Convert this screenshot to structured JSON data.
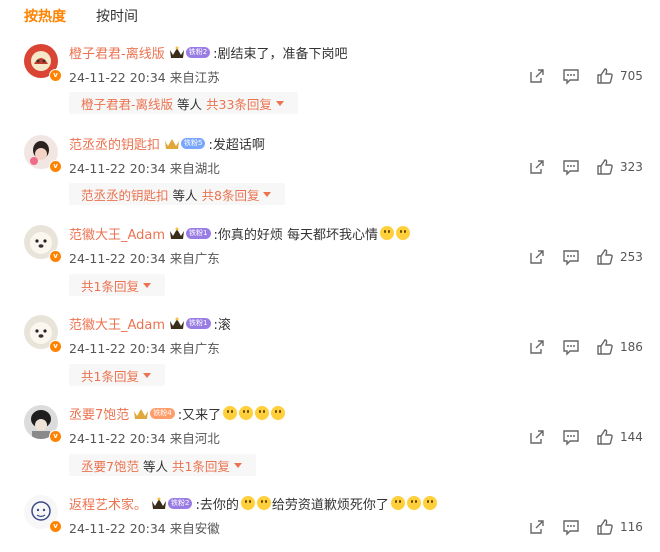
{
  "tabs": [
    {
      "label": "按热度"
    },
    {
      "label": "按时间"
    }
  ],
  "comments": [
    {
      "user": "橙子君君-离线版",
      "fan_badge": "铁粉2",
      "text": ":剧结束了，准备下岗吧",
      "time": "24-11-22 20:34 来自江苏",
      "likes": "705",
      "reply_user": "橙子君君-离线版",
      "reply_mid": "等人",
      "reply_count": "共33条回复"
    },
    {
      "user": "范丞丞的钥匙扣",
      "fan_badge": "铁粉5",
      "text": ":发超话啊",
      "time": "24-11-22 20:34 来自湖北",
      "likes": "323",
      "reply_user": "范丞丞的钥匙扣",
      "reply_mid": "等人",
      "reply_count": "共8条回复"
    },
    {
      "user": "范徽大王_Adam",
      "fan_badge": "铁粉1",
      "text": ":你真的好烦 每天都坏我心情",
      "time": "24-11-22 20:34 来自广东",
      "likes": "253",
      "reply_count": "共1条回复"
    },
    {
      "user": "范徽大王_Adam",
      "fan_badge": "铁粉1",
      "text": ":滚",
      "time": "24-11-22 20:34 来自广东",
      "likes": "186",
      "reply_count": "共1条回复"
    },
    {
      "user": "丞要7饱范",
      "fan_badge": "铁粉4",
      "text": ":又来了",
      "time": "24-11-22 20:34 来自河北",
      "likes": "144",
      "reply_user": "丞要7饱范",
      "reply_mid": "等人",
      "reply_count": "共1条回复"
    },
    {
      "user": "返程艺术家。",
      "fan_badge": "铁粉2",
      "text_a": ":去你的",
      "text_b": "给劳资道歉烦死你了",
      "time": "24-11-22 20:34 来自安徽",
      "likes": "116"
    }
  ],
  "icons": {
    "share": "share-icon",
    "comment": "comment-icon",
    "like": "thumbs-up-icon",
    "verified": "verified-badge-icon",
    "crown": "crown-icon",
    "dropdown": "caret-down-icon"
  },
  "colors": {
    "accent": "#ff8200",
    "username": "#eb7350"
  }
}
